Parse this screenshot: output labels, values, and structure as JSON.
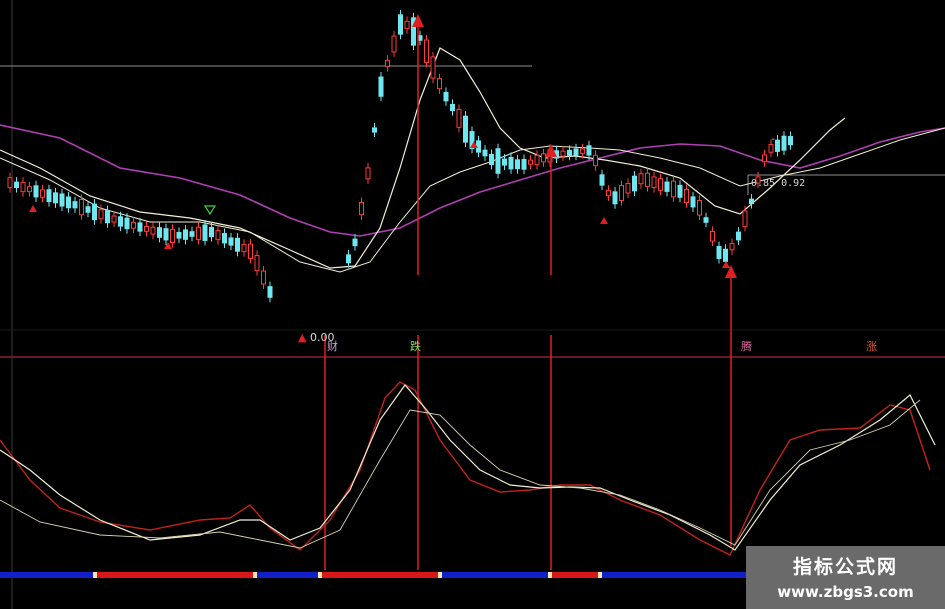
{
  "colors": {
    "background": "#000000",
    "bullish_candle": "#ff3b3b",
    "bearish_candle": "#6ee7f0",
    "ma_short": "#f2efd6",
    "ma_long": "#b03fb3",
    "signal_line": "#e02020",
    "kdj_k": "#c0221d",
    "kdj_d": "#f2efd6",
    "divider": "#8a2330",
    "bar_red": "#d81818",
    "bar_blue": "#1220c8"
  },
  "indicator_labels": {
    "price_flag": "0.00",
    "label_1": "财",
    "label_2": "跌",
    "label_3": "腾",
    "label_4": "涨"
  },
  "price_notes": {
    "range": "0.85 0.92",
    "top_mark": "-"
  },
  "watermark": {
    "title": "指标公式网",
    "url": "www.zbgs3.com"
  }
}
